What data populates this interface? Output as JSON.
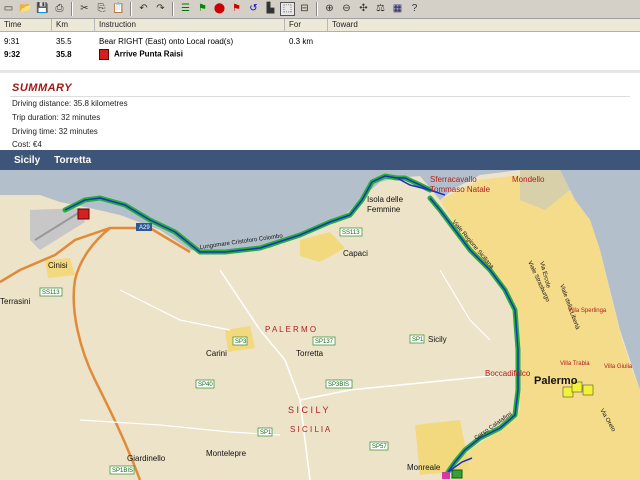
{
  "toolbar": {
    "buttons": [
      "new-icon",
      "open-icon",
      "save-icon",
      "print-icon",
      "cut-icon",
      "copy-icon",
      "paste-icon",
      "undo-icon",
      "redo-icon",
      "route-icon",
      "start-icon",
      "end-icon",
      "stop-icon",
      "detour-icon",
      "avoid-icon",
      "select-icon",
      "road-icon",
      "zoom-in-icon",
      "zoom-out-icon",
      "pan-icon",
      "measure-icon",
      "map-view-icon",
      "help-icon"
    ]
  },
  "table": {
    "headers": [
      "Time",
      "Km",
      "Instruction",
      "For",
      "Toward"
    ],
    "rows": [
      {
        "time": "9:31",
        "km": "35.5",
        "instruction": "Bear RIGHT (East) onto Local road(s)",
        "for": "0.3 km",
        "toward": ""
      },
      {
        "time": "9:32",
        "km": "35.8",
        "instruction": "Arrive Punta Raisi",
        "for": "",
        "toward": ""
      }
    ]
  },
  "summary": {
    "title": "SUMMARY",
    "lines": [
      "Driving distance:  35.8 kilometres",
      "Trip duration:  32 minutes",
      "Driving time:  32 minutes",
      "Cost:  €4"
    ]
  },
  "mapbar": {
    "region": "Sicily",
    "place": "Torretta"
  },
  "map": {
    "labels": [
      {
        "text": "Sferracavallo",
        "cls": "red"
      },
      {
        "text": "Tommaso Natale",
        "cls": "red"
      },
      {
        "text": "Mondello",
        "cls": "red"
      },
      {
        "text": "Isola delle",
        "cls": "dark"
      },
      {
        "text": "Femmine",
        "cls": "dark"
      },
      {
        "text": "Capaci",
        "cls": "dark"
      },
      {
        "text": "Cinisi",
        "cls": "dark"
      },
      {
        "text": "Terrasini",
        "cls": "dark"
      },
      {
        "text": "Carini",
        "cls": "dark"
      },
      {
        "text": "Torretta",
        "cls": "dark"
      },
      {
        "text": "Sicily",
        "cls": "dark"
      },
      {
        "text": "Palermo",
        "cls": "big"
      },
      {
        "text": "Boccadifalco",
        "cls": "red"
      },
      {
        "text": "Monreale",
        "cls": "dark"
      },
      {
        "text": "Montelepre",
        "cls": "dark"
      },
      {
        "text": "Giardinello",
        "cls": "dark"
      },
      {
        "text": "P A L E R M O",
        "cls": "redsp"
      },
      {
        "text": "S I C I L Y",
        "cls": "redsp2"
      },
      {
        "text": "S I C I L I A",
        "cls": "redsp"
      },
      {
        "text": "Lungomare Cristoforo Colombo",
        "cls": "road"
      },
      {
        "text": "Viale Regione Siciliana",
        "cls": "road"
      },
      {
        "text": "Corso Calatafimi",
        "cls": "road"
      },
      {
        "text": "Viale della Libertà",
        "cls": "road"
      },
      {
        "text": "Viale Strasburgo",
        "cls": "road"
      },
      {
        "text": "Villa Sperlinga",
        "cls": "tiny"
      },
      {
        "text": "Villa Trabia",
        "cls": "tiny"
      },
      {
        "text": "Villa Giulia",
        "cls": "tiny"
      },
      {
        "text": "Via Oreto",
        "cls": "road"
      },
      {
        "text": "Via Ercole",
        "cls": "road"
      }
    ],
    "shields": [
      "SS113",
      "A29",
      "SS113",
      "SP3",
      "SP1",
      "SP40",
      "SP137",
      "SP3BIS",
      "SP1",
      "SP57",
      "SP1BIS"
    ]
  }
}
